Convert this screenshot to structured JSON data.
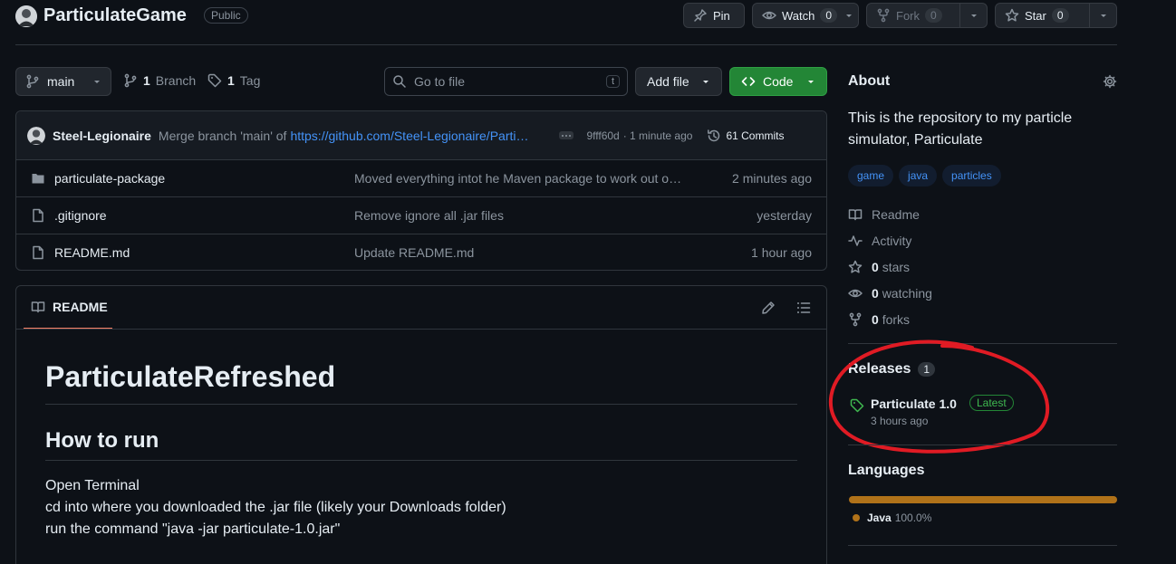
{
  "repo": {
    "name": "ParticulateGame",
    "visibility": "Public"
  },
  "actions": {
    "pin": "Pin",
    "watch": "Watch",
    "watch_count": "0",
    "fork": "Fork",
    "fork_count": "0",
    "star": "Star",
    "star_count": "0"
  },
  "toolbar": {
    "branch": "main",
    "branches_count": "1",
    "branches_label": "Branch",
    "tags_count": "1",
    "tags_label": "Tag",
    "go_to_file_placeholder": "Go to file",
    "go_to_file_shortcut": "t",
    "add_file": "Add file",
    "code": "Code"
  },
  "latest_commit": {
    "author": "Steel-Legionaire",
    "message_prefix": "Merge branch 'main' of",
    "message_link": "https://github.com/Steel-Legionaire/Parti…",
    "hash": "9fff60d",
    "time": "· 1 minute ago",
    "commits_label": "61 Commits"
  },
  "files": [
    {
      "name": "particulate-package",
      "type": "folder",
      "message": "Moved everything intot he Maven package to work out o…",
      "time": "2 minutes ago"
    },
    {
      "name": ".gitignore",
      "type": "file",
      "message": "Remove ignore all .jar files",
      "time": "yesterday"
    },
    {
      "name": "README.md",
      "type": "file",
      "message": "Update README.md",
      "time": "1 hour ago"
    }
  ],
  "readme": {
    "tab_label": "README",
    "h1": "ParticulateRefreshed",
    "h2": "How to run",
    "lines": [
      "Open Terminal",
      "cd into where you downloaded the .jar file (likely your Downloads folder)",
      "run the command \"java -jar particulate-1.0.jar\""
    ]
  },
  "about": {
    "title": "About",
    "description": "This is the repository to my particle simulator, Particulate",
    "topics": [
      "game",
      "java",
      "particles"
    ],
    "readme_link": "Readme",
    "activity_link": "Activity",
    "stars_count": "0",
    "stars_label": "stars",
    "watching_count": "0",
    "watching_label": "watching",
    "forks_count": "0",
    "forks_label": "forks"
  },
  "releases": {
    "title": "Releases",
    "count": "1",
    "latest_name": "Particulate 1.0",
    "latest_badge": "Latest",
    "latest_time": "3 hours ago"
  },
  "languages": {
    "title": "Languages",
    "items": [
      {
        "name": "Java",
        "percent": "100.0%",
        "color": "#b07219",
        "share": 1.0
      }
    ]
  },
  "colors": {
    "accent_green": "#238636",
    "link_blue": "#4493f8",
    "annotation_red": "#e01b24"
  }
}
